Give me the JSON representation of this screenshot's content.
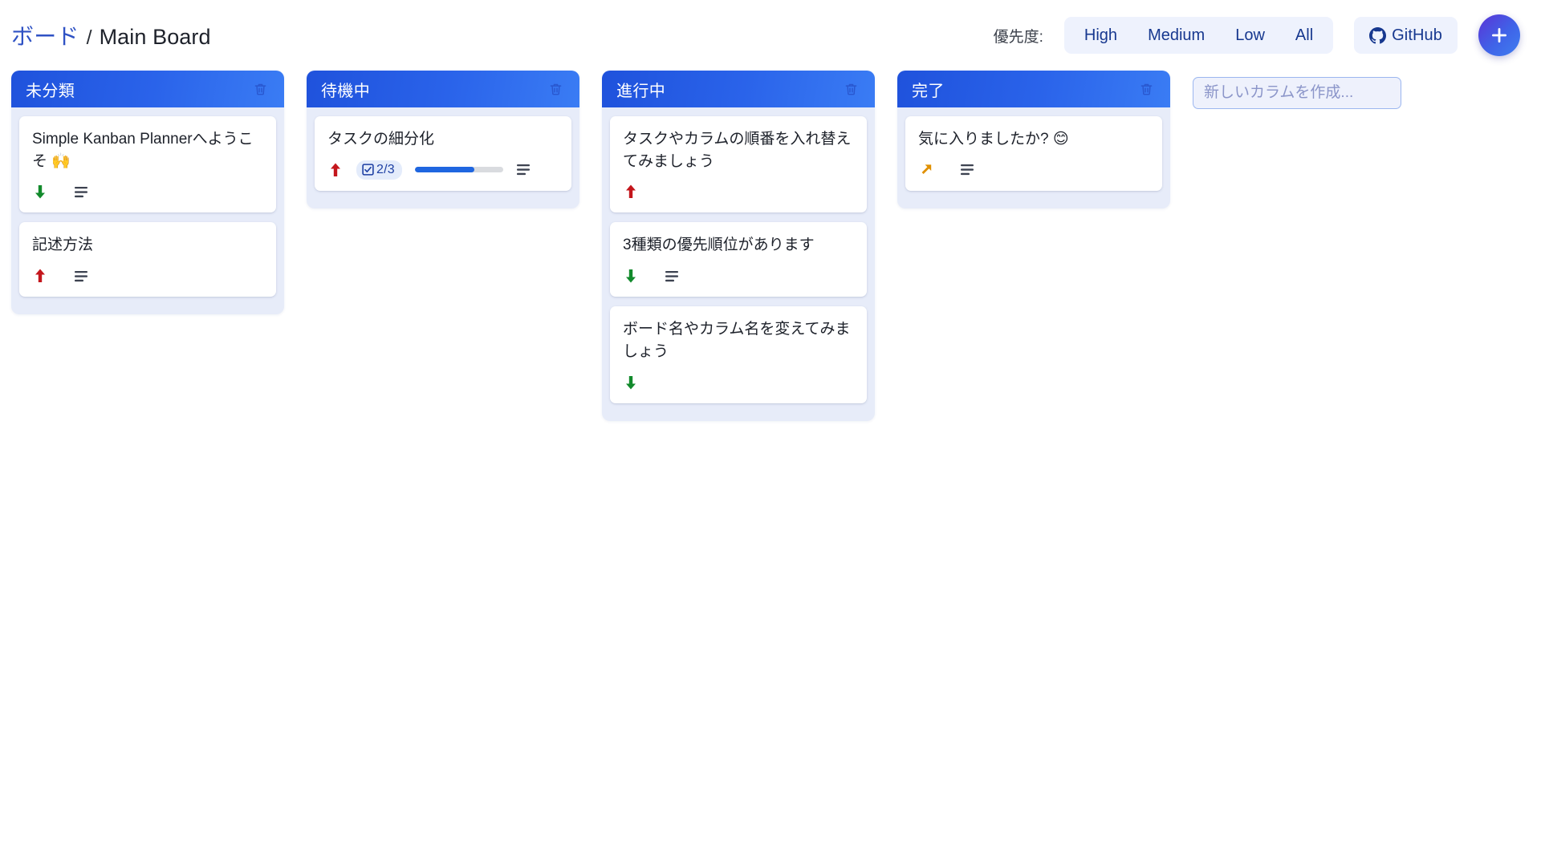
{
  "header": {
    "breadcrumb_root": "ボード",
    "breadcrumb_separator": "/",
    "breadcrumb_current": "Main Board",
    "priority_filter_label": "優先度:",
    "priority_filters": [
      {
        "label": "High"
      },
      {
        "label": "Medium"
      },
      {
        "label": "Low"
      },
      {
        "label": "All"
      }
    ],
    "github_label": "GitHub",
    "add_button_label": "+"
  },
  "new_column": {
    "placeholder": "新しいカラムを作成..."
  },
  "colors": {
    "accent_blue": "#2563eb",
    "header_gradient_start": "#1f52dc",
    "header_gradient_end": "#3a7cf4",
    "column_body": "#e7ecf9",
    "filter_chip_bg": "#eef2fd",
    "priority_high": "#c4161c",
    "priority_medium": "#e09000",
    "priority_low": "#128a2c",
    "progress_fill": "#1f66e0",
    "progress_track": "#d9dbdf",
    "fab_gradient_start": "#5b33d6",
    "fab_gradient_end": "#3f7ff0"
  },
  "columns": [
    {
      "title": "未分類",
      "cards": [
        {
          "title": "Simple Kanban Plannerへようこそ 🙌",
          "priority": "low",
          "has_description": true,
          "checklist": null
        },
        {
          "title": "記述方法",
          "priority": "high",
          "has_description": true,
          "checklist": null
        }
      ]
    },
    {
      "title": "待機中",
      "cards": [
        {
          "title": "タスクの細分化",
          "priority": "high",
          "has_description": true,
          "checklist": {
            "done": 2,
            "total": 3,
            "label": "2/3",
            "percent": 67
          }
        }
      ]
    },
    {
      "title": "進行中",
      "cards": [
        {
          "title": "タスクやカラムの順番を入れ替えてみましょう",
          "priority": "high",
          "has_description": false,
          "checklist": null
        },
        {
          "title": "3種類の優先順位があります",
          "priority": "low",
          "has_description": true,
          "checklist": null
        },
        {
          "title": "ボード名やカラム名を変えてみましょう",
          "priority": "low",
          "has_description": false,
          "checklist": null
        }
      ]
    },
    {
      "title": "完了",
      "cards": [
        {
          "title": "気に入りましたか? 😊",
          "priority": "medium",
          "has_description": true,
          "checklist": null
        }
      ]
    }
  ]
}
